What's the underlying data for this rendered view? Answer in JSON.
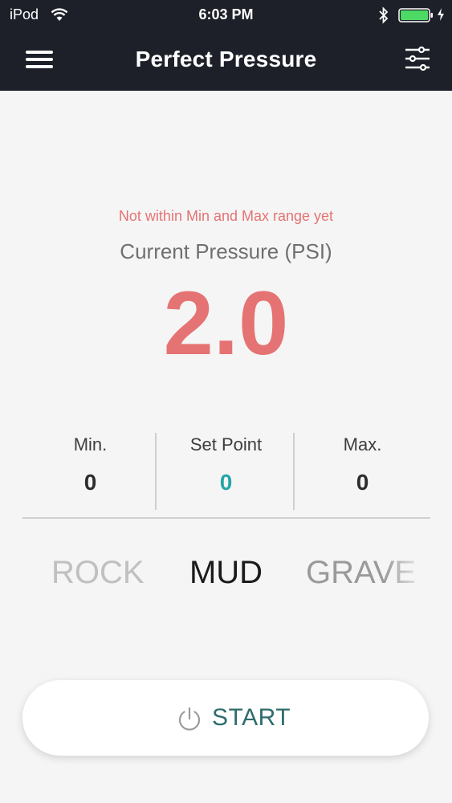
{
  "status_bar": {
    "carrier": "iPod",
    "time": "6:03 PM",
    "battery_color": "#4cd964"
  },
  "header": {
    "title": "Perfect Pressure",
    "menu_icon": "hamburger-menu-icon",
    "settings_icon": "sliders-icon"
  },
  "pressure": {
    "warning": "Not within Min and Max range yet",
    "label": "Current Pressure (PSI)",
    "value": "2.0"
  },
  "stats": {
    "min_label": "Min.",
    "min_value": "0",
    "setpoint_label": "Set Point",
    "setpoint_value": "0",
    "max_label": "Max.",
    "max_value": "0"
  },
  "terrain": {
    "options": [
      "ROCK",
      "MUD",
      "GRAVEL"
    ],
    "visible_text": [
      "ROCK",
      "MUD",
      "GRAVE"
    ],
    "selected": "MUD"
  },
  "start_button": {
    "label": "START",
    "icon": "power-icon"
  },
  "colors": {
    "header_bg": "#1d2029",
    "warning": "#e57373",
    "setpoint": "#26a6a6",
    "start_text": "#2f6c6c"
  }
}
